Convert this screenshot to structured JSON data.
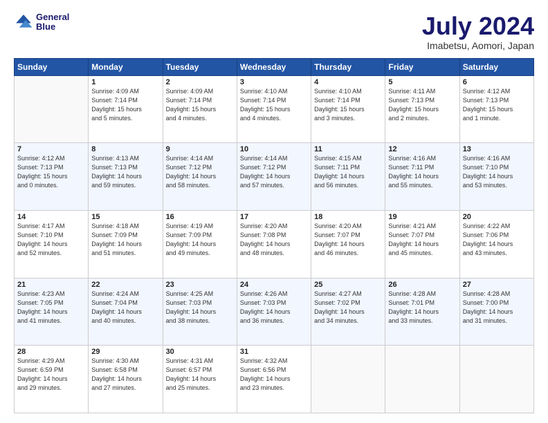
{
  "header": {
    "logo_line1": "General",
    "logo_line2": "Blue",
    "main_title": "July 2024",
    "subtitle": "Imabetsu, Aomori, Japan"
  },
  "days_of_week": [
    "Sunday",
    "Monday",
    "Tuesday",
    "Wednesday",
    "Thursday",
    "Friday",
    "Saturday"
  ],
  "weeks": [
    [
      {
        "day": "",
        "info": ""
      },
      {
        "day": "1",
        "info": "Sunrise: 4:09 AM\nSunset: 7:14 PM\nDaylight: 15 hours\nand 5 minutes."
      },
      {
        "day": "2",
        "info": "Sunrise: 4:09 AM\nSunset: 7:14 PM\nDaylight: 15 hours\nand 4 minutes."
      },
      {
        "day": "3",
        "info": "Sunrise: 4:10 AM\nSunset: 7:14 PM\nDaylight: 15 hours\nand 4 minutes."
      },
      {
        "day": "4",
        "info": "Sunrise: 4:10 AM\nSunset: 7:14 PM\nDaylight: 15 hours\nand 3 minutes."
      },
      {
        "day": "5",
        "info": "Sunrise: 4:11 AM\nSunset: 7:13 PM\nDaylight: 15 hours\nand 2 minutes."
      },
      {
        "day": "6",
        "info": "Sunrise: 4:12 AM\nSunset: 7:13 PM\nDaylight: 15 hours\nand 1 minute."
      }
    ],
    [
      {
        "day": "7",
        "info": "Sunrise: 4:12 AM\nSunset: 7:13 PM\nDaylight: 15 hours\nand 0 minutes."
      },
      {
        "day": "8",
        "info": "Sunrise: 4:13 AM\nSunset: 7:13 PM\nDaylight: 14 hours\nand 59 minutes."
      },
      {
        "day": "9",
        "info": "Sunrise: 4:14 AM\nSunset: 7:12 PM\nDaylight: 14 hours\nand 58 minutes."
      },
      {
        "day": "10",
        "info": "Sunrise: 4:14 AM\nSunset: 7:12 PM\nDaylight: 14 hours\nand 57 minutes."
      },
      {
        "day": "11",
        "info": "Sunrise: 4:15 AM\nSunset: 7:11 PM\nDaylight: 14 hours\nand 56 minutes."
      },
      {
        "day": "12",
        "info": "Sunrise: 4:16 AM\nSunset: 7:11 PM\nDaylight: 14 hours\nand 55 minutes."
      },
      {
        "day": "13",
        "info": "Sunrise: 4:16 AM\nSunset: 7:10 PM\nDaylight: 14 hours\nand 53 minutes."
      }
    ],
    [
      {
        "day": "14",
        "info": "Sunrise: 4:17 AM\nSunset: 7:10 PM\nDaylight: 14 hours\nand 52 minutes."
      },
      {
        "day": "15",
        "info": "Sunrise: 4:18 AM\nSunset: 7:09 PM\nDaylight: 14 hours\nand 51 minutes."
      },
      {
        "day": "16",
        "info": "Sunrise: 4:19 AM\nSunset: 7:09 PM\nDaylight: 14 hours\nand 49 minutes."
      },
      {
        "day": "17",
        "info": "Sunrise: 4:20 AM\nSunset: 7:08 PM\nDaylight: 14 hours\nand 48 minutes."
      },
      {
        "day": "18",
        "info": "Sunrise: 4:20 AM\nSunset: 7:07 PM\nDaylight: 14 hours\nand 46 minutes."
      },
      {
        "day": "19",
        "info": "Sunrise: 4:21 AM\nSunset: 7:07 PM\nDaylight: 14 hours\nand 45 minutes."
      },
      {
        "day": "20",
        "info": "Sunrise: 4:22 AM\nSunset: 7:06 PM\nDaylight: 14 hours\nand 43 minutes."
      }
    ],
    [
      {
        "day": "21",
        "info": "Sunrise: 4:23 AM\nSunset: 7:05 PM\nDaylight: 14 hours\nand 41 minutes."
      },
      {
        "day": "22",
        "info": "Sunrise: 4:24 AM\nSunset: 7:04 PM\nDaylight: 14 hours\nand 40 minutes."
      },
      {
        "day": "23",
        "info": "Sunrise: 4:25 AM\nSunset: 7:03 PM\nDaylight: 14 hours\nand 38 minutes."
      },
      {
        "day": "24",
        "info": "Sunrise: 4:26 AM\nSunset: 7:03 PM\nDaylight: 14 hours\nand 36 minutes."
      },
      {
        "day": "25",
        "info": "Sunrise: 4:27 AM\nSunset: 7:02 PM\nDaylight: 14 hours\nand 34 minutes."
      },
      {
        "day": "26",
        "info": "Sunrise: 4:28 AM\nSunset: 7:01 PM\nDaylight: 14 hours\nand 33 minutes."
      },
      {
        "day": "27",
        "info": "Sunrise: 4:28 AM\nSunset: 7:00 PM\nDaylight: 14 hours\nand 31 minutes."
      }
    ],
    [
      {
        "day": "28",
        "info": "Sunrise: 4:29 AM\nSunset: 6:59 PM\nDaylight: 14 hours\nand 29 minutes."
      },
      {
        "day": "29",
        "info": "Sunrise: 4:30 AM\nSunset: 6:58 PM\nDaylight: 14 hours\nand 27 minutes."
      },
      {
        "day": "30",
        "info": "Sunrise: 4:31 AM\nSunset: 6:57 PM\nDaylight: 14 hours\nand 25 minutes."
      },
      {
        "day": "31",
        "info": "Sunrise: 4:32 AM\nSunset: 6:56 PM\nDaylight: 14 hours\nand 23 minutes."
      },
      {
        "day": "",
        "info": ""
      },
      {
        "day": "",
        "info": ""
      },
      {
        "day": "",
        "info": ""
      }
    ]
  ]
}
